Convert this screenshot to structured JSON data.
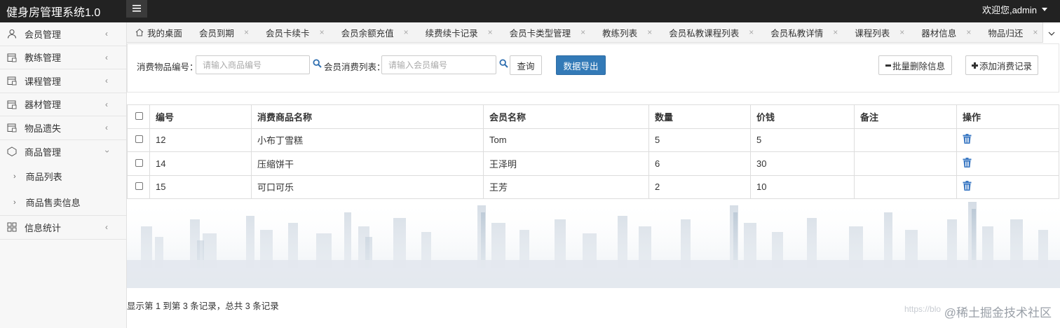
{
  "app": {
    "title": "健身房管理系统1.0",
    "user_greeting": "欢迎您,admin"
  },
  "sidebar": {
    "items": [
      {
        "label": "会员管理",
        "icon": "user-icon"
      },
      {
        "label": "教练管理",
        "icon": "calendar-icon"
      },
      {
        "label": "课程管理",
        "icon": "calendar-icon"
      },
      {
        "label": "器材管理",
        "icon": "calendar-icon"
      },
      {
        "label": "物品遗失",
        "icon": "calendar-icon"
      },
      {
        "label": "商品管理",
        "icon": "box-icon",
        "expanded": true,
        "children": [
          {
            "label": "商品列表"
          },
          {
            "label": "商品售卖信息"
          }
        ]
      },
      {
        "label": "信息统计",
        "icon": "grid-icon"
      }
    ]
  },
  "tabs": [
    {
      "label": "我的桌面",
      "closable": false
    },
    {
      "label": "会员到期"
    },
    {
      "label": "会员卡续卡"
    },
    {
      "label": "会员余额充值"
    },
    {
      "label": "续费续卡记录"
    },
    {
      "label": "会员卡类型管理"
    },
    {
      "label": "教练列表"
    },
    {
      "label": "会员私教课程列表"
    },
    {
      "label": "会员私教详情"
    },
    {
      "label": "课程列表"
    },
    {
      "label": "器材信息"
    },
    {
      "label": "物品归还"
    }
  ],
  "toolbar": {
    "item_id_label": "消费物品编号：",
    "item_id_placeholder": "请输入商品编号",
    "member_label": "会员消费列表：",
    "member_placeholder": "请输入会员编号",
    "query_label": "查询",
    "export_label": "数据导出",
    "batch_delete_label": "批量删除信息",
    "add_record_label": "添加消费记录"
  },
  "table": {
    "columns": [
      "编号",
      "消费商品名称",
      "会员名称",
      "数量",
      "价钱",
      "备注",
      "操作"
    ],
    "rows": [
      {
        "id": "12",
        "product": "小布丁雪糕",
        "member": "Tom",
        "qty": "5",
        "price": "5",
        "note": ""
      },
      {
        "id": "14",
        "product": "压缩饼干",
        "member": "王泽明",
        "qty": "6",
        "price": "30",
        "note": ""
      },
      {
        "id": "15",
        "product": "可口可乐",
        "member": "王芳",
        "qty": "2",
        "price": "10",
        "note": ""
      }
    ]
  },
  "pagination": {
    "summary": "显示第 1 到第 3 条记录，总共 3 条记录"
  },
  "watermark": {
    "text": "@稀土掘金技术社区",
    "url": "https://blo"
  },
  "colors": {
    "topbar": "#222222",
    "primary": "#337ab7",
    "accent_icon": "#3a78c3"
  }
}
